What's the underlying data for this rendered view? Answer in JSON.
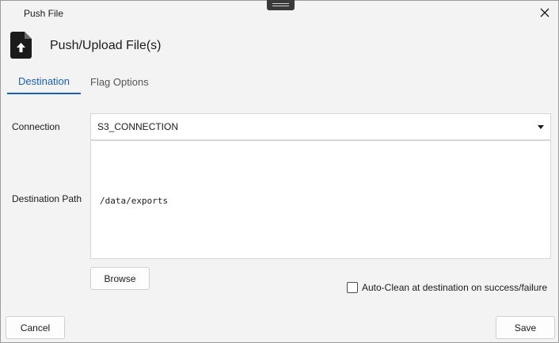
{
  "window": {
    "title": "Push File",
    "close_icon": "close-icon"
  },
  "header": {
    "icon": "file-upload-icon",
    "title": "Push/Upload File(s)"
  },
  "tabs": [
    {
      "label": "Destination",
      "active": true
    },
    {
      "label": "Flag Options",
      "active": false
    }
  ],
  "form": {
    "connection_label": "Connection",
    "connection_value": "S3_CONNECTION",
    "destination_label": "Destination Path",
    "destination_value": "/data/exports",
    "browse_label": "Browse",
    "auto_clean_label": "Auto-Clean at destination on success/failure",
    "auto_clean_checked": false
  },
  "footer": {
    "cancel_label": "Cancel",
    "save_label": "Save"
  },
  "colors": {
    "accent": "#1a5fb4",
    "background": "#f3f3f3"
  }
}
